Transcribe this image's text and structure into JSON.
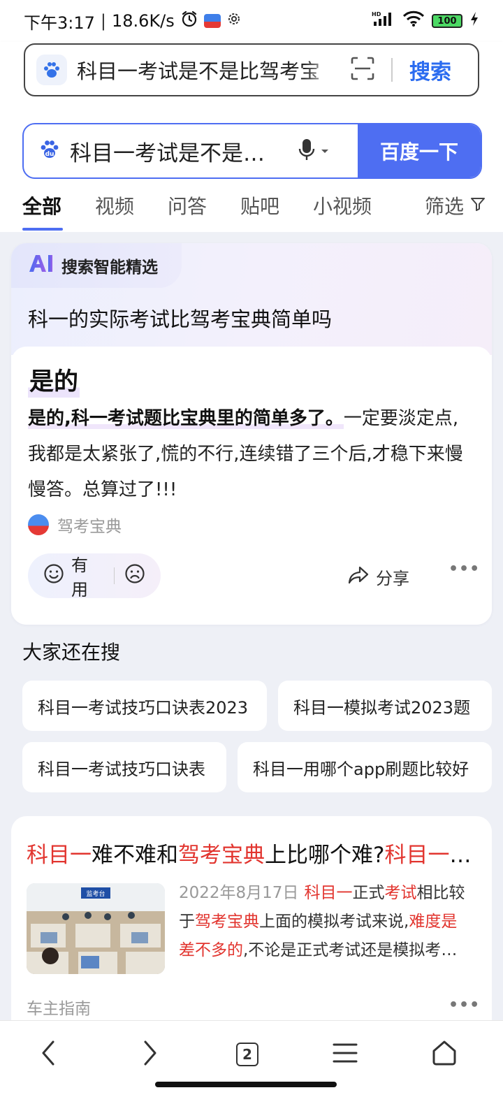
{
  "status_bar": {
    "time": "下午3:17",
    "net_speed": "18.6K/s",
    "signal_label": "HD",
    "battery": "100",
    "icons": [
      "alarm-icon",
      "app-icon",
      "settings-icon",
      "signal-icon",
      "wifi-icon",
      "battery-icon",
      "charging-icon"
    ]
  },
  "browser": {
    "url_text": "科目一考试是不是比驾考宝",
    "search_label": "搜索"
  },
  "search": {
    "query": "科目一考试是不是比驾考宝典简单",
    "button": "百度一下"
  },
  "tabs": [
    "全部",
    "视频",
    "问答",
    "贴吧",
    "小视频"
  ],
  "active_tab": "全部",
  "filter_label": "筛选",
  "ai_card": {
    "tag": "搜索智能精选",
    "question": "科一的实际考试比驾考宝典简单吗",
    "answer": "是的",
    "text_bold": "是的,科一考试题比宝典里的简单多了。",
    "text_rest": "一定要淡定点,我都是太紧张了,慌的不行,连续错了三个后,才稳下来慢慢答。总算过了!!!",
    "source": "驾考宝典",
    "useful": "有用",
    "share": "分享"
  },
  "others": {
    "title": "大家还在搜",
    "chips": [
      "科目一考试技巧口诀表2023",
      "科目一模拟考试2023题",
      "科目一考试技巧口诀表",
      "科目一用哪个app刷题比较好"
    ]
  },
  "result": {
    "title_parts": [
      "科目一",
      "难不难和",
      "驾考宝典",
      "上比哪个难?",
      "科目一难不难"
    ],
    "date": "2022年8月17日",
    "snippet_parts": [
      "科目一",
      "正式",
      "考试",
      "相比较于",
      "驾考宝典",
      "上面的模拟考试来说,",
      "难度是差不多的",
      ",不论是正式考试还是模拟考试,都是从题库中随机抽题"
    ],
    "thumb_sign": "监考台",
    "source": "车主指南"
  },
  "colors": {
    "accent": "#4e6ef2",
    "highlight": "#e2352f",
    "page_bg": "#eef0f6"
  }
}
